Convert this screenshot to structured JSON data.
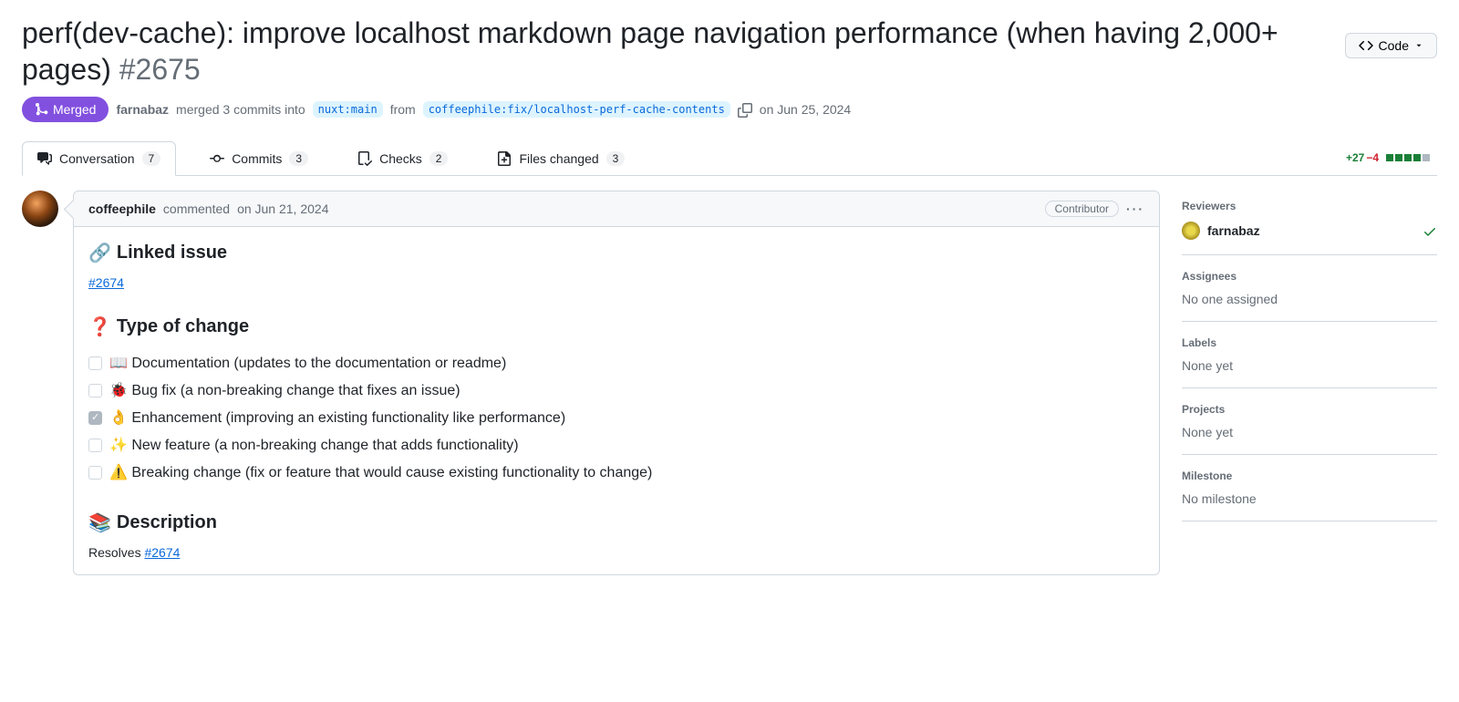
{
  "header": {
    "title": "perf(dev-cache): improve localhost markdown page navigation performance (when having 2,000+ pages)",
    "number": "#2675",
    "code_button": "Code"
  },
  "meta": {
    "state": "Merged",
    "actor": "farnabaz",
    "action_prefix": "merged 3 commits into",
    "base_branch": "nuxt:main",
    "from_word": "from",
    "head_branch": "coffeephile:fix/localhost-perf-cache-contents",
    "date": "on Jun 25, 2024"
  },
  "tabs": {
    "conversation": {
      "label": "Conversation",
      "count": "7"
    },
    "commits": {
      "label": "Commits",
      "count": "3"
    },
    "checks": {
      "label": "Checks",
      "count": "2"
    },
    "files": {
      "label": "Files changed",
      "count": "3"
    }
  },
  "diffstat": {
    "additions": "+27",
    "deletions": "−4"
  },
  "comment": {
    "author": "coffeephile",
    "action": "commented",
    "date": "on Jun 21, 2024",
    "role": "Contributor",
    "linked_issue_heading": "Linked issue",
    "linked_issue_ref": "#2674",
    "type_heading": "Type of change",
    "types": {
      "doc": "📖 Documentation (updates to the documentation or readme)",
      "bug": "🐞 Bug fix (a non-breaking change that fixes an issue)",
      "enh": "👌 Enhancement (improving an existing functionality like performance)",
      "feat": "✨ New feature (a non-breaking change that adds functionality)",
      "break": "⚠️ Breaking change (fix or feature that would cause existing functionality to change)"
    },
    "desc_heading": "Description",
    "resolves_prefix": "Resolves ",
    "resolves_ref": "#2674"
  },
  "sidebar": {
    "reviewers": {
      "title": "Reviewers",
      "name": "farnabaz"
    },
    "assignees": {
      "title": "Assignees",
      "text": "No one assigned"
    },
    "labels": {
      "title": "Labels",
      "text": "None yet"
    },
    "projects": {
      "title": "Projects",
      "text": "None yet"
    },
    "milestone": {
      "title": "Milestone",
      "text": "No milestone"
    }
  }
}
